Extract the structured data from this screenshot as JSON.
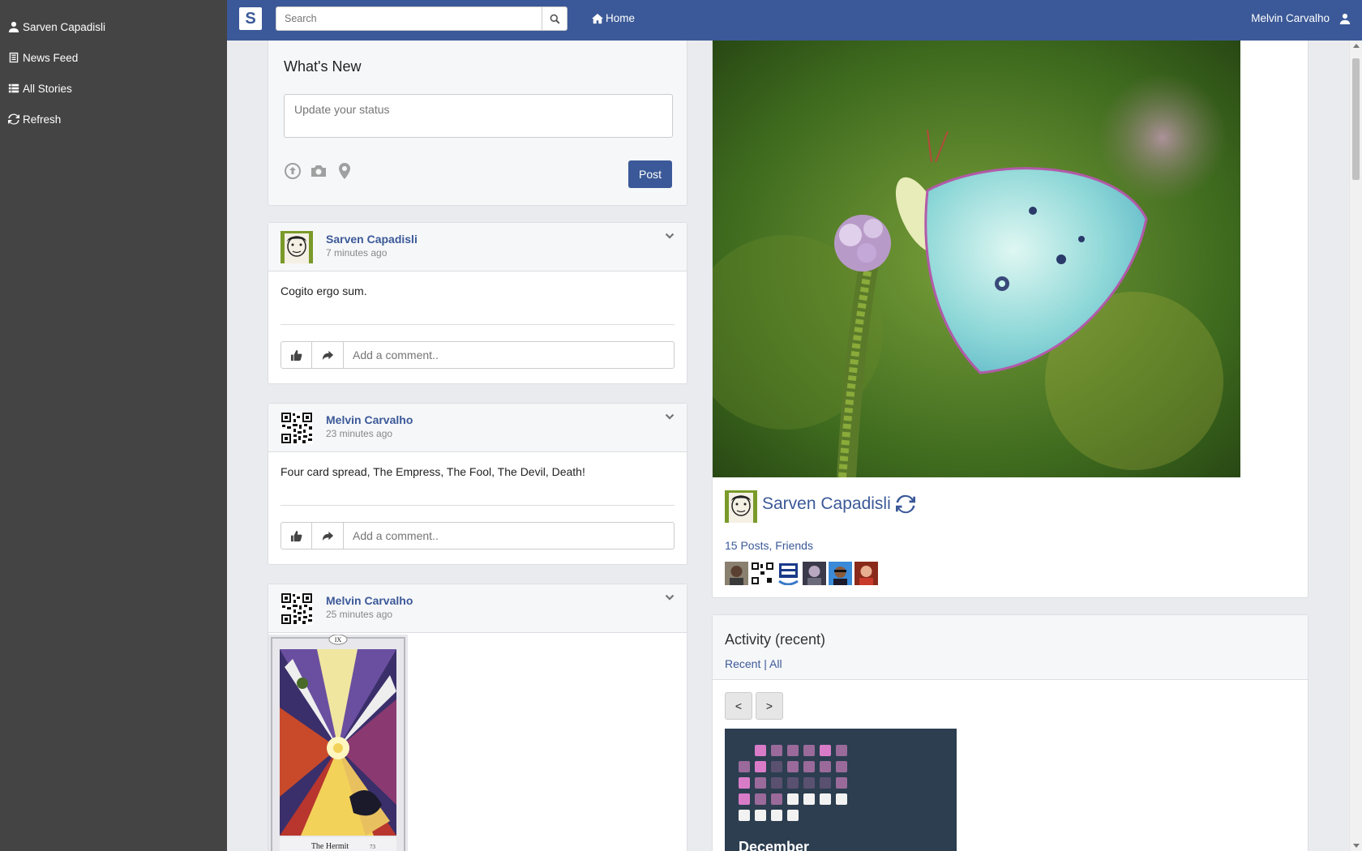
{
  "brand": {
    "letter": "S"
  },
  "search": {
    "placeholder": "Search"
  },
  "nav": {
    "home_label": "Home",
    "user_name": "Melvin Carvalho"
  },
  "sidebar": {
    "items": [
      {
        "label": "Sarven Capadisli",
        "icon": "user-icon"
      },
      {
        "label": "News Feed",
        "icon": "newspaper-icon"
      },
      {
        "label": "All Stories",
        "icon": "list-icon"
      },
      {
        "label": "Refresh",
        "icon": "refresh-icon"
      }
    ]
  },
  "composer": {
    "title": "What's New",
    "placeholder": "Update your status",
    "post_label": "Post",
    "icons": [
      "upload-icon",
      "camera-icon",
      "map-marker-icon"
    ]
  },
  "posts": [
    {
      "author": "Sarven Capadisli",
      "time": "7 minutes ago",
      "text": "Cogito ergo sum.",
      "comment_placeholder": "Add a comment.."
    },
    {
      "author": "Melvin Carvalho",
      "time": "23 minutes ago",
      "text": "Four card spread, The Empress, The Fool, The Devil, Death!",
      "comment_placeholder": "Add a comment.."
    },
    {
      "author": "Melvin Carvalho",
      "time": "25 minutes ago",
      "card_numeral": "IX",
      "card_caption": "The Hermit",
      "card_footer_number": "73"
    }
  ],
  "profile": {
    "name": "Sarven Capadisli",
    "posts_link": "15 Posts",
    "comma": ",",
    "friends_link": "Friends"
  },
  "activity": {
    "title": "Activity (recent)",
    "tab_recent": "Recent",
    "separator": "|",
    "tab_all": "All",
    "prev_label": "<",
    "next_label": ">",
    "month": "December"
  },
  "colors": {
    "brand_blue": "#3b5998",
    "sidebar_bg": "#444444",
    "calendar_bg": "#2c3e50"
  }
}
